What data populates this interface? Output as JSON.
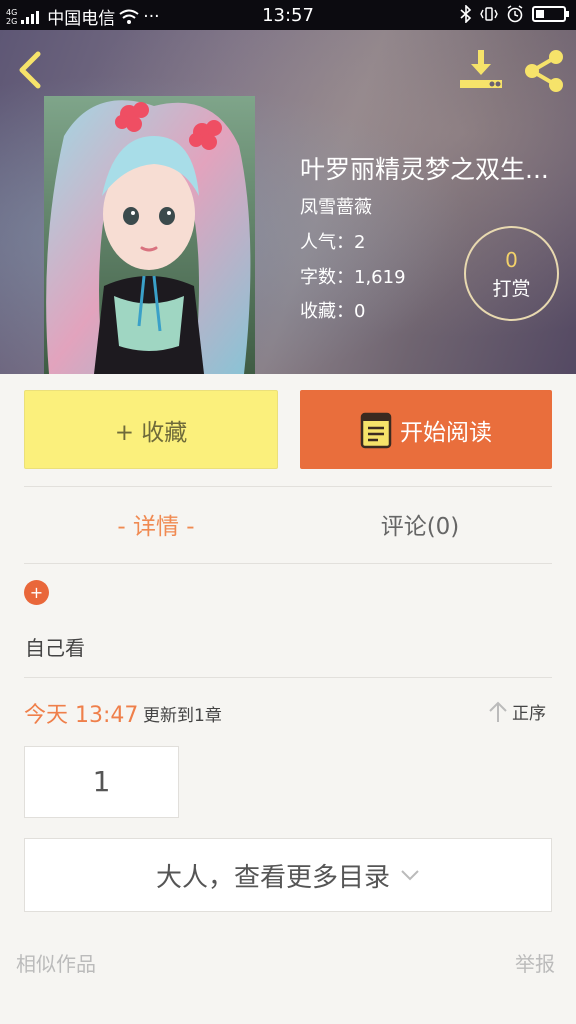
{
  "status_bar": {
    "network": "4G\n2G",
    "carrier": "中国电信",
    "more": "···",
    "time": "13:57",
    "battery_level": 0.3
  },
  "book": {
    "title": "叶罗丽精灵梦之双生...",
    "author": "凤雪蔷薇",
    "popularity": "人气：2",
    "word_count": "字数：1,619",
    "favorites": "收藏：0"
  },
  "reward": {
    "count": "0",
    "label": "打赏"
  },
  "actions": {
    "collect_label": "+ 收藏",
    "read_label": "开始阅读"
  },
  "tabs": {
    "detail": "- 详情 -",
    "comments": "评论(0)"
  },
  "detail": {
    "plus": "+",
    "description": "自己看",
    "update_time": "今天 13:47",
    "update_text": "更新到1章",
    "sort_label": "正序",
    "chapters": [
      "1"
    ],
    "more_catalog": "大人，查看更多目录"
  },
  "footer": {
    "similar": "相似作品",
    "report": "举报"
  },
  "colors": {
    "accent": "#e96e3c",
    "collect_bg": "#fbf07c",
    "icon_yellow": "#f6e36a",
    "tab_active": "#f08a52"
  }
}
